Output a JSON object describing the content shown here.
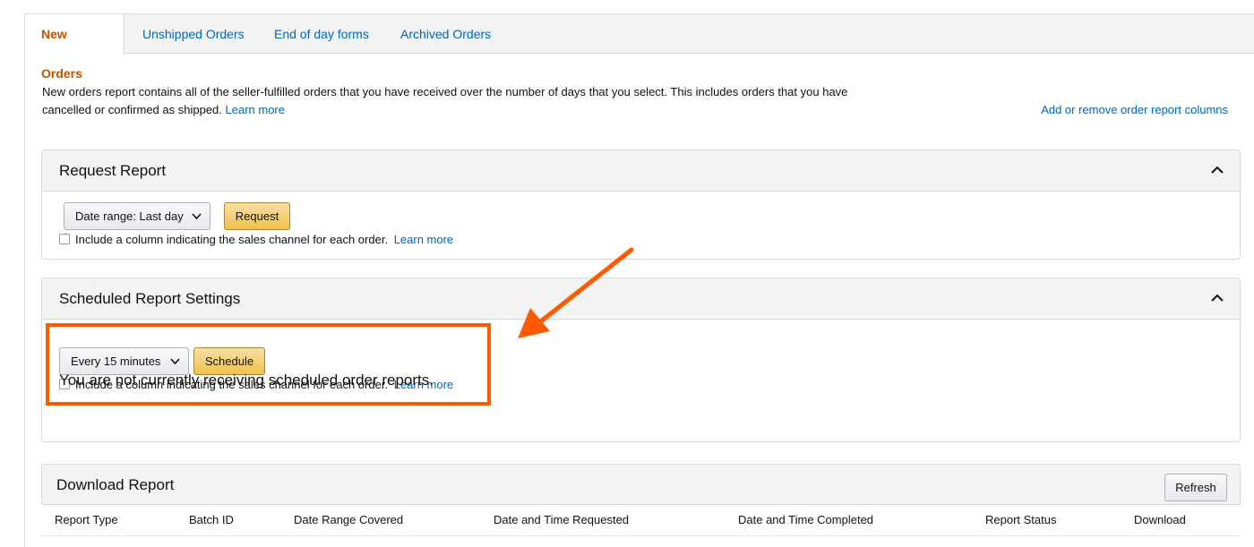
{
  "tabs": [
    {
      "label": "New Orders",
      "active": true
    },
    {
      "label": "Unshipped Orders",
      "active": false
    },
    {
      "label": "End of day forms",
      "active": false
    },
    {
      "label": "Archived Orders",
      "active": false
    }
  ],
  "intro": {
    "text": "New orders report contains all of the seller-fulfilled orders that you have received over the number of days that you select. This includes orders that you have cancelled or confirmed as shipped.",
    "learn_more": "Learn more"
  },
  "columns_link": "Add or remove order report columns",
  "request_report": {
    "title": "Request Report",
    "date_range": "Date range: Last day",
    "button": "Request",
    "checkbox_label": "Include a column indicating the sales channel for each order.",
    "learn_more": "Learn more"
  },
  "scheduled_report": {
    "title": "Scheduled Report Settings",
    "interval": "Every 15 minutes",
    "button": "Schedule",
    "checkbox_label": "Include a column indicating the sales channel for each order.",
    "learn_more": "Learn more",
    "status": "You are not currently receiving scheduled order reports."
  },
  "download_report": {
    "title": "Download Report",
    "refresh": "Refresh",
    "columns": [
      "Report Type",
      "Batch ID",
      "Date Range Covered",
      "Date and Time Requested",
      "Date and Time Completed",
      "Report Status",
      "Download"
    ]
  },
  "colors": {
    "link": "#0066c0",
    "active_tab": "#c45500",
    "annotation": "#ff5a00",
    "button_yellow": "#f0c14b"
  }
}
